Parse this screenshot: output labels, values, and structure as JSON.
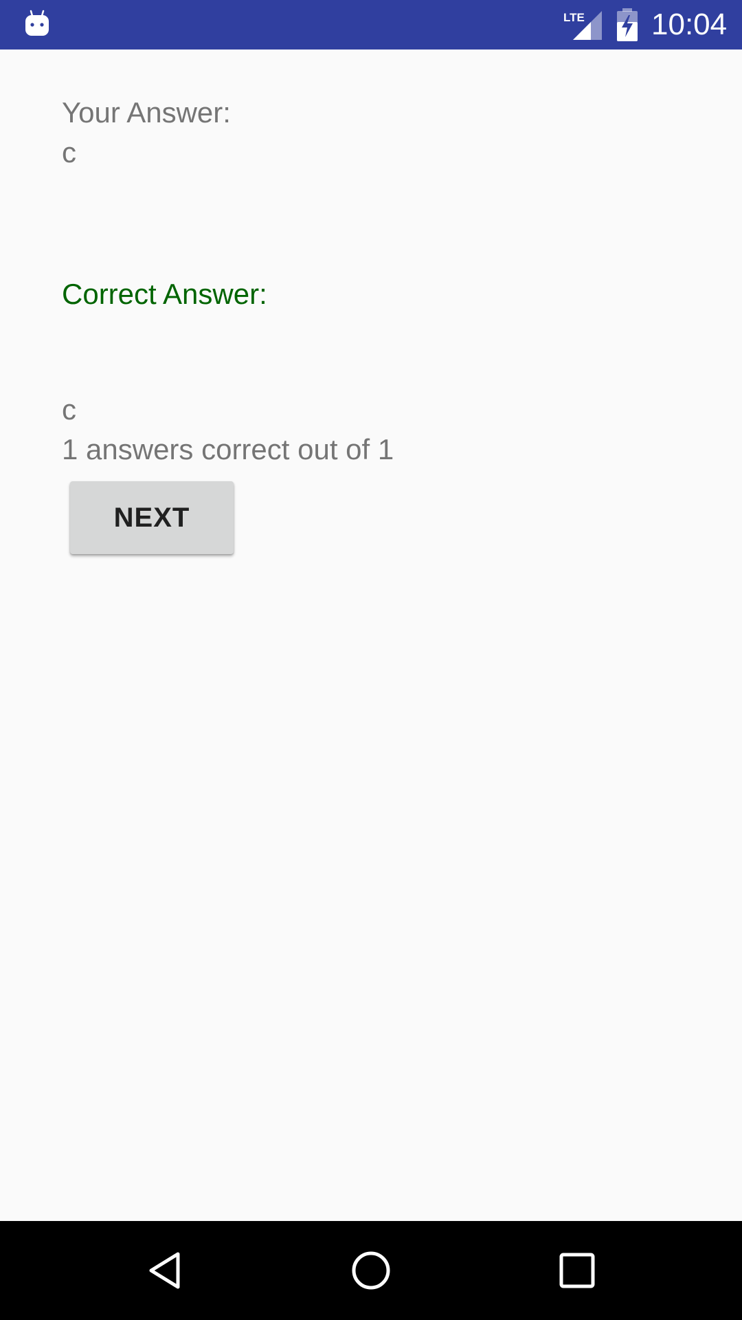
{
  "status_bar": {
    "time": "10:04",
    "network_label": "LTE",
    "icons": [
      "android-notification-icon",
      "lte-signal-icon",
      "battery-charging-icon"
    ],
    "background_color": "#303f9f"
  },
  "result": {
    "your_answer_label": "Your Answer:",
    "your_answer_value": "c",
    "correct_answer_label": "Correct Answer:",
    "correct_answer_value": "c",
    "score_text": "1 answers correct out of 1",
    "correct_label_color": "#006400"
  },
  "actions": {
    "next_label": "NEXT"
  },
  "nav_bar": {
    "icons": [
      "back-icon",
      "home-icon",
      "recents-icon"
    ]
  }
}
